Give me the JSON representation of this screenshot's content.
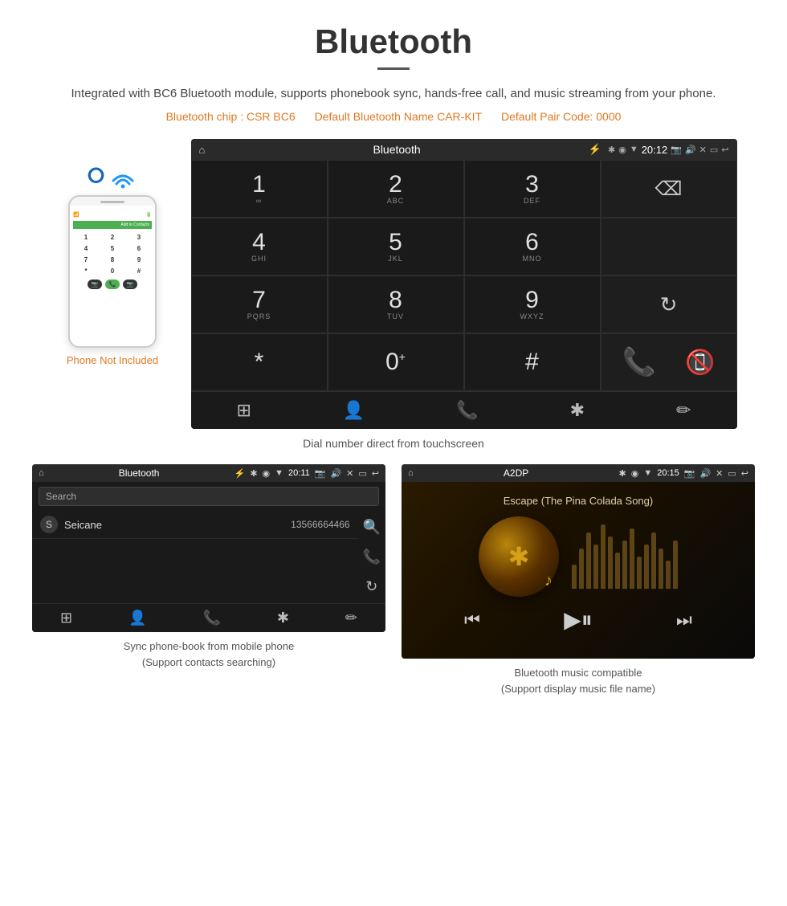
{
  "page": {
    "title": "Bluetooth",
    "divider": true,
    "subtitle": "Integrated with BC6 Bluetooth module, supports phonebook sync, hands-free call, and music streaming from your phone.",
    "specs": {
      "chip": "Bluetooth chip : CSR BC6",
      "name": "Default Bluetooth Name CAR-KIT",
      "code": "Default Pair Code: 0000"
    }
  },
  "phone_mockup": {
    "not_included_label": "Phone Not Included",
    "bt_signal_icon": "🔵",
    "contact_bar_label": "Add to Contacts"
  },
  "dial_screen": {
    "status_bar": {
      "home_icon": "⌂",
      "title": "Bluetooth",
      "usb_icon": "⚡",
      "bt_icon": "✱",
      "location_icon": "◉",
      "signal_icon": "▼",
      "time": "20:12",
      "camera_icon": "📷",
      "volume_icon": "🔊",
      "close_icon": "✕",
      "window_icon": "▭",
      "back_icon": "↩"
    },
    "keypad": [
      {
        "number": "1",
        "letters": "∞",
        "row": 0,
        "col": 0
      },
      {
        "number": "2",
        "letters": "ABC",
        "row": 0,
        "col": 1
      },
      {
        "number": "3",
        "letters": "DEF",
        "row": 0,
        "col": 2
      },
      {
        "number": "4",
        "letters": "GHI",
        "row": 1,
        "col": 0
      },
      {
        "number": "5",
        "letters": "JKL",
        "row": 1,
        "col": 1
      },
      {
        "number": "6",
        "letters": "MNO",
        "row": 1,
        "col": 2
      },
      {
        "number": "7",
        "letters": "PQRS",
        "row": 2,
        "col": 0
      },
      {
        "number": "8",
        "letters": "TUV",
        "row": 2,
        "col": 1
      },
      {
        "number": "9",
        "letters": "WXYZ",
        "row": 2,
        "col": 2
      },
      {
        "number": "*",
        "letters": "",
        "row": 3,
        "col": 0
      },
      {
        "number": "0",
        "letters": "+",
        "row": 3,
        "col": 1
      },
      {
        "number": "#",
        "letters": "",
        "row": 3,
        "col": 2
      }
    ],
    "nav": {
      "keypad_icon": "⊞",
      "contacts_icon": "👤",
      "phone_icon": "📞",
      "bt_icon": "✱",
      "settings_icon": "✏"
    }
  },
  "dial_caption": "Dial number direct from touchscreen",
  "phonebook_screen": {
    "status_bar": {
      "home_icon": "⌂",
      "title": "Bluetooth",
      "usb_icon": "⚡",
      "bt_icon": "✱",
      "time": "20:11"
    },
    "search_placeholder": "Search",
    "contacts": [
      {
        "initial": "S",
        "name": "Seicane",
        "number": "13566664466"
      }
    ],
    "side_icons": [
      "🔍",
      "📞",
      "↻"
    ],
    "nav": {
      "keypad_icon": "⊞",
      "contacts_icon": "👤",
      "phone_icon": "📞",
      "bt_icon": "✱",
      "settings_icon": "✏"
    }
  },
  "phonebook_caption": {
    "line1": "Sync phone-book from mobile phone",
    "line2": "(Support contacts searching)"
  },
  "music_screen": {
    "status_bar": {
      "home_icon": "⌂",
      "title": "A2DP",
      "bt_icon": "✱",
      "time": "20:15"
    },
    "song_title": "Escape (The Pina Colada Song)",
    "eq_bars": [
      30,
      50,
      70,
      55,
      80,
      65,
      45,
      60,
      75,
      40,
      55,
      70,
      50,
      35,
      60
    ],
    "controls": {
      "prev_icon": "⏮",
      "play_icon": "▶⏸",
      "next_icon": "⏭"
    }
  },
  "music_caption": {
    "line1": "Bluetooth music compatible",
    "line2": "(Support display music file name)"
  }
}
